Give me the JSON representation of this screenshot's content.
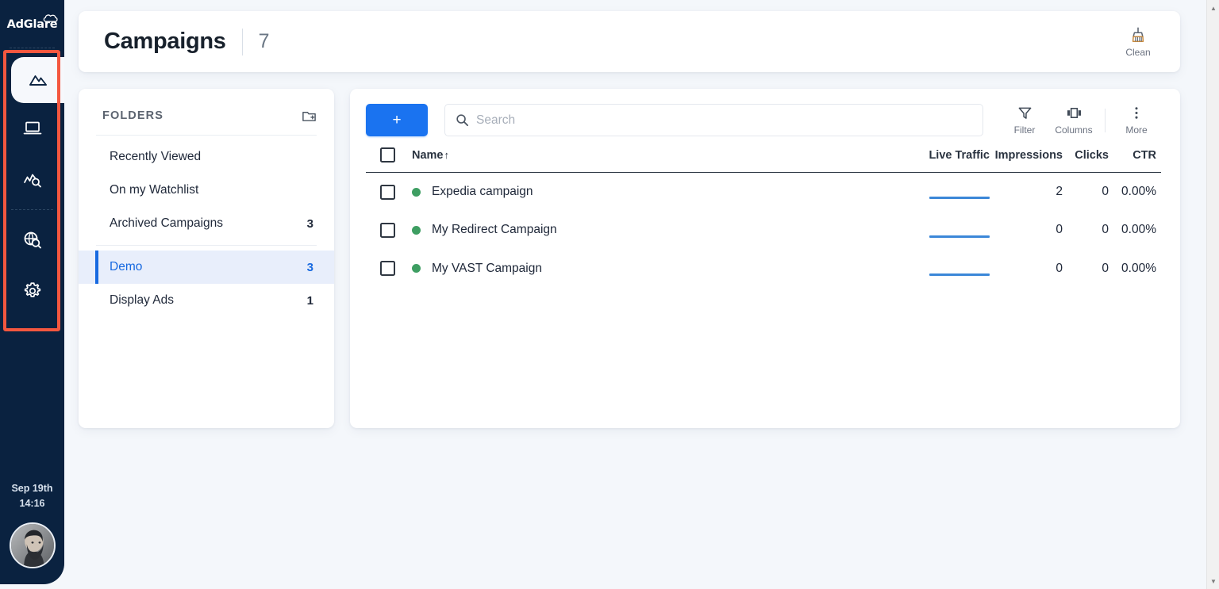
{
  "brand": {
    "name": "AdGlare",
    "logo_icon": "cloud-icon"
  },
  "sidebar": {
    "nav_items": [
      {
        "label": "Campaigns",
        "icon": "mountains-icon",
        "active": true
      },
      {
        "label": "Websites",
        "icon": "laptop-icon",
        "active": false
      },
      {
        "label": "Reports",
        "icon": "chart-search-icon",
        "active": false
      },
      {
        "label": "Discover",
        "icon": "globe-search-icon",
        "active": false
      },
      {
        "label": "Settings",
        "icon": "gear-icon",
        "active": false
      }
    ],
    "date": "Sep 19th",
    "time": "14:16",
    "avatar_name": "user-avatar",
    "highlight_color": "#f4573f"
  },
  "header": {
    "title": "Campaigns",
    "count": "7",
    "clean_label": "Clean",
    "clean_icon": "broom-icon"
  },
  "folders": {
    "title": "FOLDERS",
    "add_icon": "folder-plus-icon",
    "items": [
      {
        "label": "Recently Viewed",
        "count": "",
        "selected": false
      },
      {
        "label": "On my Watchlist",
        "count": "",
        "selected": false
      },
      {
        "label": "Archived Campaigns",
        "count": "3",
        "selected": false
      },
      {
        "label": "Demo",
        "count": "3",
        "selected": true
      },
      {
        "label": "Display Ads",
        "count": "1",
        "selected": false
      }
    ]
  },
  "toolbar": {
    "add_label": "+",
    "search_placeholder": "Search",
    "search_value": "",
    "search_icon": "search-icon",
    "filter_label": "Filter",
    "filter_icon": "funnel-icon",
    "columns_label": "Columns",
    "columns_icon": "columns-icon",
    "more_label": "More",
    "more_icon": "dots-vertical-icon"
  },
  "table": {
    "columns": [
      "Name",
      "Live Traffic",
      "Impressions",
      "Clicks",
      "CTR"
    ],
    "sort_column": "Name",
    "sort_direction": "↑",
    "rows": [
      {
        "name": "Expedia campaign",
        "status": "active",
        "live_traffic": "flat",
        "impressions": "2",
        "clicks": "0",
        "ctr": "0.00%"
      },
      {
        "name": "My Redirect Campaign",
        "status": "active",
        "live_traffic": "flat",
        "impressions": "0",
        "clicks": "0",
        "ctr": "0.00%"
      },
      {
        "name": "My VAST Campaign",
        "status": "active",
        "live_traffic": "flat",
        "impressions": "0",
        "clicks": "0",
        "ctr": "0.00%"
      }
    ]
  },
  "colors": {
    "sidebar_bg": "#0a2240",
    "accent_blue": "#1a73f0",
    "status_green": "#3e9e62",
    "highlight_red": "#f4573f",
    "page_bg": "#f4f7fb"
  }
}
